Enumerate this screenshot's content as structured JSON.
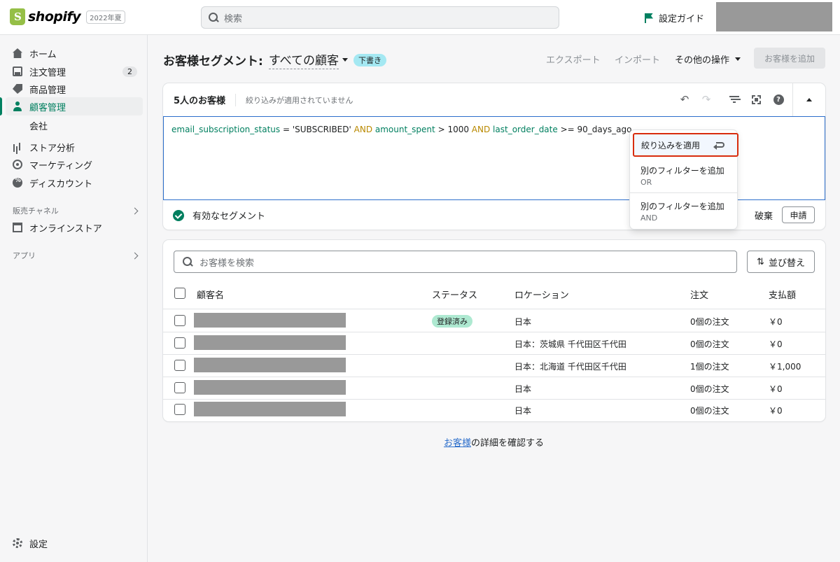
{
  "topbar": {
    "logo_text": "shopify",
    "edition": "2022年夏",
    "search_placeholder": "検索",
    "setup_guide": "設定ガイド"
  },
  "sidebar": {
    "items": [
      {
        "label": "ホーム",
        "icon": "home-icon"
      },
      {
        "label": "注文管理",
        "icon": "orders-icon",
        "badge": "2"
      },
      {
        "label": "商品管理",
        "icon": "tag-icon"
      },
      {
        "label": "顧客管理",
        "icon": "person-icon",
        "active": true
      },
      {
        "label": "会社"
      },
      {
        "label": "ストア分析",
        "icon": "bar-chart-icon"
      },
      {
        "label": "マーケティング",
        "icon": "target-icon"
      },
      {
        "label": "ディスカウント",
        "icon": "discount-icon"
      }
    ],
    "sales_channels_label": "販売チャネル",
    "online_store": "オンラインストア",
    "apps_label": "アプリ",
    "settings": "設定"
  },
  "header": {
    "title": "お客様セグメント:",
    "segment_name": "すべての顧客",
    "draft_badge": "下書き",
    "export": "エクスポート",
    "import": "インポート",
    "more_actions": "その他の操作",
    "add_customer": "お客様を追加"
  },
  "segment_card": {
    "count": "5人のお客様",
    "no_filter": "絞り込みが適用されていません",
    "query": {
      "f1": "email_subscription_status",
      "op1": " = ",
      "v1": "'SUBSCRIBED'",
      "kw1": " AND ",
      "f2": "amount_spent",
      "op2": " > ",
      "v2": "1000",
      "kw2": " AND ",
      "f3": "last_order_date",
      "op3": " >= ",
      "v3": "90_days_ago"
    },
    "valid_segment": "有効なセグメント",
    "discard": "破棄",
    "submit": "申請"
  },
  "dropdown": {
    "apply": "絞り込みを適用",
    "add_or": "別のフィルターを追加",
    "or": "OR",
    "add_and": "別のフィルターを追加",
    "and": "AND"
  },
  "customers": {
    "search_placeholder": "お客様を検索",
    "sort": "並び替え",
    "columns": [
      "顧客名",
      "ステータス",
      "ロケーション",
      "注文",
      "支払額"
    ],
    "rows": [
      {
        "status": "登録済み",
        "location": "日本",
        "orders": "0個の注文",
        "spent": "￥0"
      },
      {
        "status": "",
        "location": "日本：茨城県 千代田区千代田",
        "orders": "0個の注文",
        "spent": "￥0"
      },
      {
        "status": "",
        "location": "日本：北海道 千代田区千代田",
        "orders": "1個の注文",
        "spent": "￥1,000"
      },
      {
        "status": "",
        "location": "日本",
        "orders": "0個の注文",
        "spent": "￥0"
      },
      {
        "status": "",
        "location": "日本",
        "orders": "0個の注文",
        "spent": "￥0"
      }
    ]
  },
  "footer": {
    "link": "お客様",
    "text": "の詳細を確認する"
  }
}
